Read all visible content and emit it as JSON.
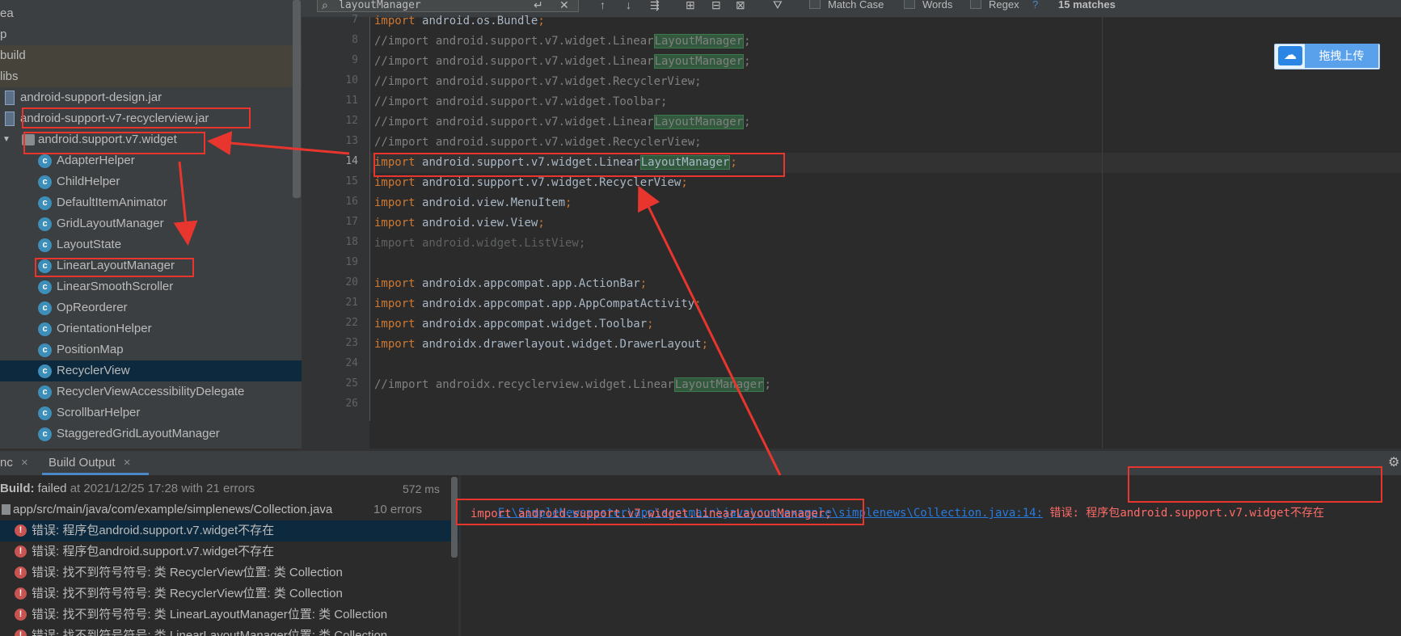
{
  "project_tree": {
    "items": [
      {
        "label": "ea",
        "kind": "folder-partial",
        "indent": 0
      },
      {
        "label": "p",
        "kind": "folder-partial",
        "indent": 0
      },
      {
        "label": "build",
        "kind": "folder",
        "indent": 0
      },
      {
        "label": "libs",
        "kind": "folder",
        "indent": 0
      },
      {
        "label": "android-support-design.jar",
        "kind": "jar"
      },
      {
        "label": "android-support-v7-recyclerview.jar",
        "kind": "jar"
      },
      {
        "label": "android.support.v7.widget",
        "kind": "package"
      },
      {
        "label": "AdapterHelper",
        "kind": "class"
      },
      {
        "label": "ChildHelper",
        "kind": "class"
      },
      {
        "label": "DefaultItemAnimator",
        "kind": "class"
      },
      {
        "label": "GridLayoutManager",
        "kind": "class"
      },
      {
        "label": "LayoutState",
        "kind": "class"
      },
      {
        "label": "LinearLayoutManager",
        "kind": "class"
      },
      {
        "label": "LinearSmoothScroller",
        "kind": "class"
      },
      {
        "label": "OpReorderer",
        "kind": "class"
      },
      {
        "label": "OrientationHelper",
        "kind": "class"
      },
      {
        "label": "PositionMap",
        "kind": "class"
      },
      {
        "label": "RecyclerView",
        "kind": "class",
        "selected": true
      },
      {
        "label": "RecyclerViewAccessibilityDelegate",
        "kind": "class"
      },
      {
        "label": "ScrollbarHelper",
        "kind": "class"
      },
      {
        "label": "StaggeredGridLayoutManager",
        "kind": "class"
      }
    ]
  },
  "find_bar": {
    "query": "layoutManager",
    "match_case_label": "Match Case",
    "words_label": "Words",
    "regex_label": "Regex",
    "help": "?",
    "match_count": "15 matches"
  },
  "editor": {
    "lines": [
      {
        "n": "7",
        "segments": [
          {
            "t": "import ",
            "c": "kw"
          },
          {
            "t": "android.os.Bundle"
          },
          {
            "t": ";",
            "c": "kw"
          }
        ]
      },
      {
        "n": "8",
        "segments": [
          {
            "t": "//import android.support.v7.widget.Linear",
            "c": "cm"
          },
          {
            "t": "LayoutManager",
            "c": "cm hl"
          },
          {
            "t": ";",
            "c": "cm"
          }
        ]
      },
      {
        "n": "9",
        "segments": [
          {
            "t": "//import android.support.v7.widget.Linear",
            "c": "cm"
          },
          {
            "t": "LayoutManager",
            "c": "cm hl"
          },
          {
            "t": ";",
            "c": "cm"
          }
        ]
      },
      {
        "n": "10",
        "segments": [
          {
            "t": "//import android.support.v7.widget.RecyclerView;",
            "c": "cm"
          }
        ]
      },
      {
        "n": "11",
        "segments": [
          {
            "t": "//import android.support.v7.widget.Toolbar;",
            "c": "cm"
          }
        ]
      },
      {
        "n": "12",
        "segments": [
          {
            "t": "//import android.support.v7.widget.Linear",
            "c": "cm"
          },
          {
            "t": "LayoutManager",
            "c": "cm hl"
          },
          {
            "t": ";",
            "c": "cm"
          }
        ]
      },
      {
        "n": "13",
        "segments": [
          {
            "t": "//import android.support.v7.widget.RecyclerView;",
            "c": "cm"
          }
        ]
      },
      {
        "n": "14",
        "current": true,
        "segments": [
          {
            "t": "import ",
            "c": "kw"
          },
          {
            "t": "android.support.v7.widget.Linear"
          },
          {
            "t": "LayoutManager",
            "c": "hl"
          },
          {
            "t": ";",
            "c": "kw"
          }
        ]
      },
      {
        "n": "15",
        "segments": [
          {
            "t": "import ",
            "c": "kw"
          },
          {
            "t": "android.support.v7.widget.RecyclerView"
          },
          {
            "t": ";",
            "c": "kw"
          }
        ]
      },
      {
        "n": "16",
        "segments": [
          {
            "t": "import ",
            "c": "kw"
          },
          {
            "t": "android.view.MenuItem"
          },
          {
            "t": ";",
            "c": "kw"
          }
        ]
      },
      {
        "n": "17",
        "segments": [
          {
            "t": "import ",
            "c": "kw"
          },
          {
            "t": "android.view.View"
          },
          {
            "t": ";",
            "c": "kw"
          }
        ]
      },
      {
        "n": "18",
        "segments": [
          {
            "t": "import android.widget.ListView;",
            "c": "dim"
          }
        ]
      },
      {
        "n": "19",
        "segments": []
      },
      {
        "n": "20",
        "segments": [
          {
            "t": "import ",
            "c": "kw"
          },
          {
            "t": "androidx.appcompat.app.ActionBar"
          },
          {
            "t": ";",
            "c": "kw"
          }
        ]
      },
      {
        "n": "21",
        "segments": [
          {
            "t": "import ",
            "c": "kw"
          },
          {
            "t": "androidx.appcompat.app.AppCompatActivity"
          },
          {
            "t": ";",
            "c": "kw"
          }
        ]
      },
      {
        "n": "22",
        "segments": [
          {
            "t": "import ",
            "c": "kw"
          },
          {
            "t": "androidx.appcompat.widget.Toolbar"
          },
          {
            "t": ";",
            "c": "kw"
          }
        ]
      },
      {
        "n": "23",
        "segments": [
          {
            "t": "import ",
            "c": "kw"
          },
          {
            "t": "androidx.drawerlayout.widget.DrawerLayout"
          },
          {
            "t": ";",
            "c": "kw"
          }
        ]
      },
      {
        "n": "24",
        "segments": []
      },
      {
        "n": "25",
        "segments": [
          {
            "t": "//import androidx.recyclerview.widget.Linear",
            "c": "cm"
          },
          {
            "t": "LayoutManager",
            "c": "cm hl"
          },
          {
            "t": ";",
            "c": "cm"
          }
        ]
      },
      {
        "n": "26",
        "segments": []
      }
    ]
  },
  "baidu_upload": {
    "label": "拖拽上传"
  },
  "bottom_tabs": {
    "sync_tab": "nc",
    "build_output_tab": "Build Output",
    "close_glyph": "×"
  },
  "build_tree": {
    "summary_prefix": "Build:",
    "summary_status": " failed",
    "summary_rest": " at 2021/12/25 17:28 with 21 errors",
    "duration": "572 ms",
    "file_path": "app/src/main/java/com/example/simplenews/Collection.java",
    "file_errors": "10 errors",
    "errors": [
      {
        "text": "错误: 程序包android.support.v7.widget不存在",
        "selected": true
      },
      {
        "text": "错误: 程序包android.support.v7.widget不存在"
      },
      {
        "text": "错误: 找不到符号符号:   类 RecyclerView位置: 类 Collection"
      },
      {
        "text": "错误: 找不到符号符号:   类 RecyclerView位置: 类 Collection"
      },
      {
        "text": "错误: 找不到符号符号:   类 LinearLayoutManager位置: 类 Collection"
      },
      {
        "text": "错误: 找不到符号符号:   类 LinearLayoutManager位置: 类 Collection"
      }
    ]
  },
  "console": {
    "link": "E:\\SimpleNewsmaster\\app\\src\\main\\java\\com\\example\\simplenews\\Collection.java:14:",
    "error_prefix": " 错误: 程序包",
    "error_pkg": "android.support.v7.widget不存在",
    "line2": "import android.support.v7.widget.LinearLayoutManager;"
  },
  "colors": {
    "annotation_red": "#e8352e",
    "keyword": "#cc7832",
    "comment": "#808080",
    "link": "#287bde",
    "error_text": "#ff6b68",
    "selection": "#0d293e"
  }
}
